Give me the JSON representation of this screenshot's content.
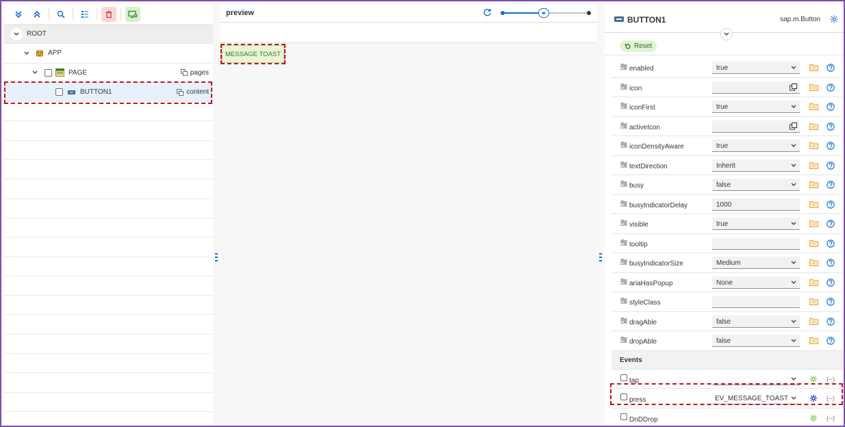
{
  "toolbar": {
    "icons": [
      "expand-all-icon",
      "collapse-all-icon",
      "search-icon",
      "list-icon",
      "delete-icon",
      "add-screen-icon"
    ]
  },
  "tree": {
    "root_label": "ROOT",
    "app_label": "APP",
    "page_label": "PAGE",
    "page_aggregation": "pages",
    "button_label": "BUTTON1",
    "button_aggregation": "content"
  },
  "preview": {
    "title": "preview",
    "toast_button_label": "MESSAGE TOAST"
  },
  "properties": {
    "control_name": "BUTTON1",
    "control_class": "sap.m.Button",
    "reset_label": "Reset",
    "rows": [
      {
        "label": "enabled",
        "value": "true",
        "kind": "dropdown"
      },
      {
        "label": "icon",
        "value": "",
        "kind": "valuehelp"
      },
      {
        "label": "iconFirst",
        "value": "true",
        "kind": "dropdown"
      },
      {
        "label": "activeIcon",
        "value": "",
        "kind": "valuehelp"
      },
      {
        "label": "iconDensityAware",
        "value": "true",
        "kind": "dropdown"
      },
      {
        "label": "textDirection",
        "value": "Inherit",
        "kind": "dropdown"
      },
      {
        "label": "busy",
        "value": "false",
        "kind": "dropdown"
      },
      {
        "label": "busyIndicatorDelay",
        "value": "1000",
        "kind": "input"
      },
      {
        "label": "visible",
        "value": "true",
        "kind": "dropdown"
      },
      {
        "label": "tooltip",
        "value": "",
        "kind": "input"
      },
      {
        "label": "busyIndicatorSize",
        "value": "Medium",
        "kind": "dropdown"
      },
      {
        "label": "ariaHasPopup",
        "value": "None",
        "kind": "dropdown"
      },
      {
        "label": "styleClass",
        "value": "",
        "kind": "input"
      },
      {
        "label": "dragAble",
        "value": "false",
        "kind": "dropdown"
      },
      {
        "label": "dropAble",
        "value": "false",
        "kind": "dropdown"
      }
    ],
    "events_header": "Events",
    "events": [
      {
        "label": "tap",
        "value": "",
        "gear_color": "#8fd16a"
      },
      {
        "label": "press",
        "value": "EV_MESSAGE_TOAST",
        "gear_color": "#2f5fd0"
      },
      {
        "label": "DnDDrop",
        "value": "",
        "gear_color": "#8fd16a"
      }
    ],
    "code_glyph": "(--)"
  },
  "colors": {
    "accent": "#0a6ed1",
    "highlight_dashed": "#c0121a",
    "frame": "#7b4fa6",
    "folder": "#e9a43c",
    "help": "#0a6ed1"
  }
}
